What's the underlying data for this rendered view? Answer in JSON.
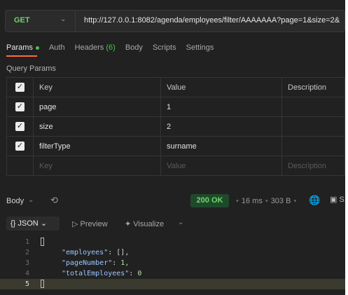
{
  "request": {
    "method": "GET",
    "url": "http://127.0.0.1:8082/agenda/employees/filter/AAAAAAA?page=1&size=2&"
  },
  "tabs": {
    "params": "Params",
    "auth": "Auth",
    "headers": "Headers",
    "headers_count": "(6)",
    "body": "Body",
    "scripts": "Scripts",
    "settings": "Settings"
  },
  "query_params": {
    "title": "Query Params",
    "columns": {
      "key": "Key",
      "value": "Value",
      "description": "Description"
    },
    "rows": [
      {
        "key": "page",
        "value": "1",
        "description": ""
      },
      {
        "key": "size",
        "value": "2",
        "description": ""
      },
      {
        "key": "filterType",
        "value": "surname",
        "description": ""
      }
    ],
    "placeholder": {
      "key": "Key",
      "value": "Value",
      "description": "Description"
    }
  },
  "response": {
    "label": "Body",
    "status": "200 OK",
    "time": "16 ms",
    "size": "303 B",
    "save_label": "S"
  },
  "format": {
    "json_label": "{} JSON",
    "preview_label": "Preview",
    "visualize_label": "Visualize"
  },
  "code": {
    "line_numbers": [
      "1",
      "2",
      "3",
      "4",
      "5"
    ],
    "employees_key": "\"employees\"",
    "employees_val": "[],",
    "page_key": "\"pageNumber\"",
    "page_val": "1,",
    "total_key": "\"totalEmployees\"",
    "total_val": "0"
  },
  "colors": {
    "background": "#212121",
    "method_green": "#6fcf6f",
    "accent_orange": "#ff6c37",
    "status_green": "#6fd36f"
  }
}
